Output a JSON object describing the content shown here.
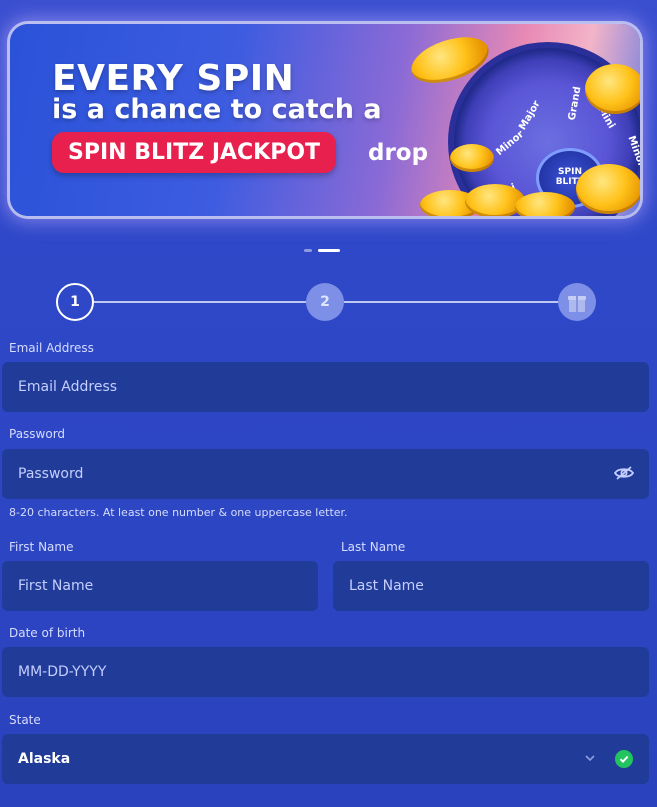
{
  "banner": {
    "line1": "EVERY SPIN",
    "line2": "is a chance to catch a",
    "pill": "SPIN BLITZ JACKPOT",
    "drop": "drop",
    "wheel_labels": [
      "Grand",
      "Major",
      "Minor",
      "Mini",
      "Mini",
      "Minor"
    ],
    "hub_logo_line1": "SPIN",
    "hub_logo_line2": "BLITZ"
  },
  "carousel": {
    "active_index": 1,
    "count": 2
  },
  "stepper": {
    "steps": [
      {
        "label": "1",
        "state": "active"
      },
      {
        "label": "2",
        "state": "inactive"
      },
      {
        "label": "",
        "icon": "gift-icon",
        "state": "inactive"
      }
    ]
  },
  "form": {
    "email": {
      "label": "Email Address",
      "placeholder": "Email Address",
      "value": ""
    },
    "password": {
      "label": "Password",
      "placeholder": "Password",
      "value": "",
      "hint": "8-20 characters. At least one number & one uppercase letter.",
      "toggle_icon": "eye-off-icon"
    },
    "first_name": {
      "label": "First Name",
      "placeholder": "First Name",
      "value": ""
    },
    "last_name": {
      "label": "Last Name",
      "placeholder": "Last Name",
      "value": ""
    },
    "dob": {
      "label": "Date of birth",
      "placeholder": "MM-DD-YYYY",
      "value": ""
    },
    "state": {
      "label": "State",
      "value": "Alaska",
      "valid": true
    }
  },
  "colors": {
    "background": "#2f48c9",
    "field_bg": "#213c98",
    "pill_red": "#e8204e",
    "valid_green": "#22c45e"
  }
}
